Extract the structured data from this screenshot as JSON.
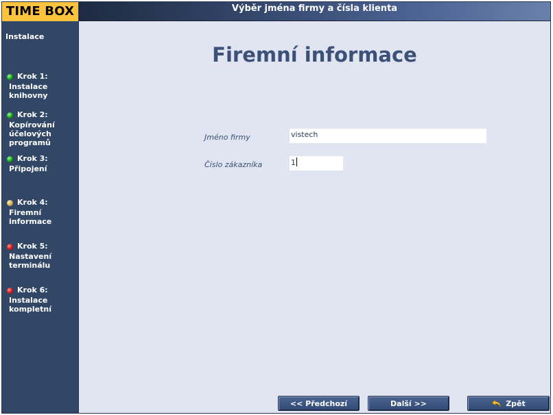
{
  "header": {
    "logo": "TIME BOX",
    "title": "Výběr jména firmy a čísla klienta"
  },
  "sidebar": {
    "heading": "Instalace",
    "steps": [
      {
        "title": "Krok 1:",
        "lines": [
          "Instalace",
          "knihovny"
        ],
        "status": "done",
        "color": "#0c9a0c"
      },
      {
        "title": "Krok 2:",
        "lines": [
          "Kopírování",
          "účelových",
          "programů"
        ],
        "status": "done",
        "color": "#0c9a0c"
      },
      {
        "title": "Krok 3:",
        "lines": [
          "Připojení"
        ],
        "status": "done",
        "color": "#0c9a0c"
      },
      {
        "title": "Krok 4:",
        "lines": [
          "Firemní",
          "informace"
        ],
        "status": "current",
        "color": "#c9a64a"
      },
      {
        "title": "Krok 5:",
        "lines": [
          "Nastavení",
          "terminálu"
        ],
        "status": "pending",
        "color": "#d01010"
      },
      {
        "title": "Krok 6:",
        "lines": [
          "Instalace",
          "kompletní"
        ],
        "status": "pending",
        "color": "#d01010"
      }
    ]
  },
  "main": {
    "title": "Firemní informace",
    "company": {
      "label": "Jméno firmy",
      "value": "vistech"
    },
    "customer": {
      "label": "Číslo zákazníka",
      "value": "1"
    }
  },
  "buttons": {
    "prev": "<< Předchozí",
    "next": "Další >>",
    "back": "Zpět",
    "back_icon": "undo-arrow-icon"
  }
}
